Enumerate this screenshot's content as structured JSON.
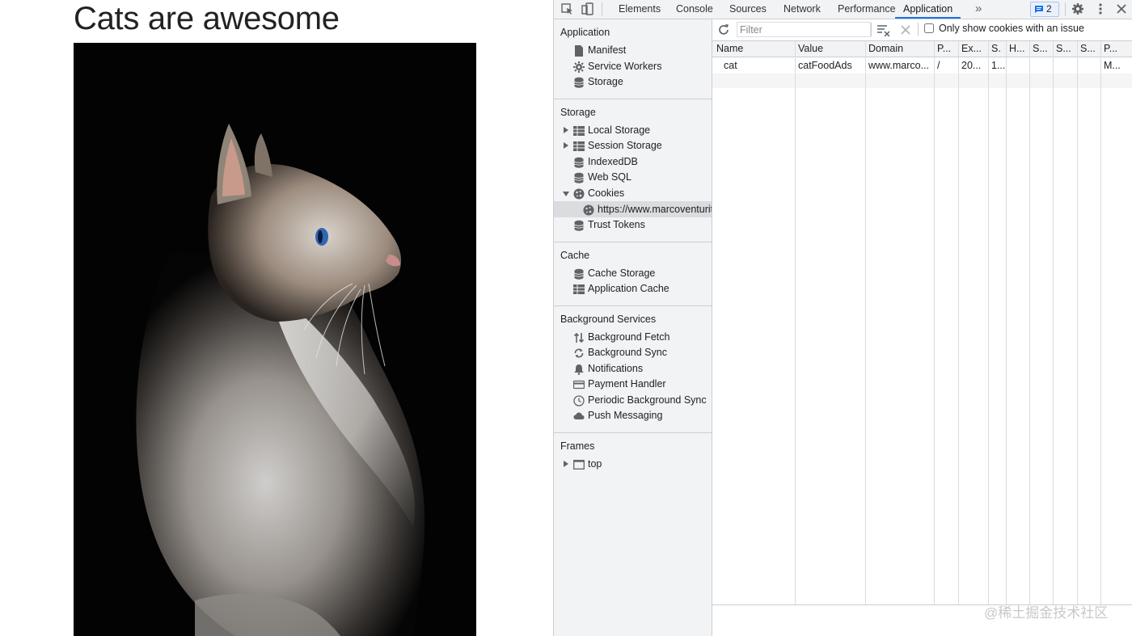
{
  "page": {
    "title": "Cats are awesome"
  },
  "devtools": {
    "tabs": [
      "Elements",
      "Console",
      "Sources",
      "Network",
      "Performance",
      "Application"
    ],
    "active_tab": "Application",
    "more_tabs_glyph": "»",
    "issues_count": "2",
    "sidebar": {
      "application": {
        "title": "Application",
        "items": [
          "Manifest",
          "Service Workers",
          "Storage"
        ]
      },
      "storage": {
        "title": "Storage",
        "items": [
          "Local Storage",
          "Session Storage",
          "IndexedDB",
          "Web SQL",
          "Cookies"
        ],
        "cookie_child": "https://www.marcoventuriti",
        "trust_tokens": "Trust Tokens"
      },
      "cache": {
        "title": "Cache",
        "items": [
          "Cache Storage",
          "Application Cache"
        ]
      },
      "background_services": {
        "title": "Background Services",
        "items": [
          "Background Fetch",
          "Background Sync",
          "Notifications",
          "Payment Handler",
          "Periodic Background Sync",
          "Push Messaging"
        ]
      },
      "frames": {
        "title": "Frames",
        "items": [
          "top"
        ]
      }
    },
    "toolbar": {
      "filter_placeholder": "Filter",
      "only_issue_label": "Only show cookies with an issue"
    },
    "cookies_table": {
      "headers": [
        "Name",
        "Value",
        "Domain",
        "P...",
        "Ex...",
        "S.",
        "H...",
        "S...",
        "S...",
        "S...",
        "P..."
      ],
      "rows": [
        [
          "cat",
          "catFoodAds",
          "www.marco...",
          "/",
          "20...",
          "1...",
          "",
          "",
          "",
          "",
          "M..."
        ]
      ]
    }
  },
  "watermark": "@稀土掘金技术社区",
  "colors": {
    "accent": "#1a73e8",
    "sidebar_bg": "#f1f3f4",
    "selected_row": "#dadce0"
  }
}
